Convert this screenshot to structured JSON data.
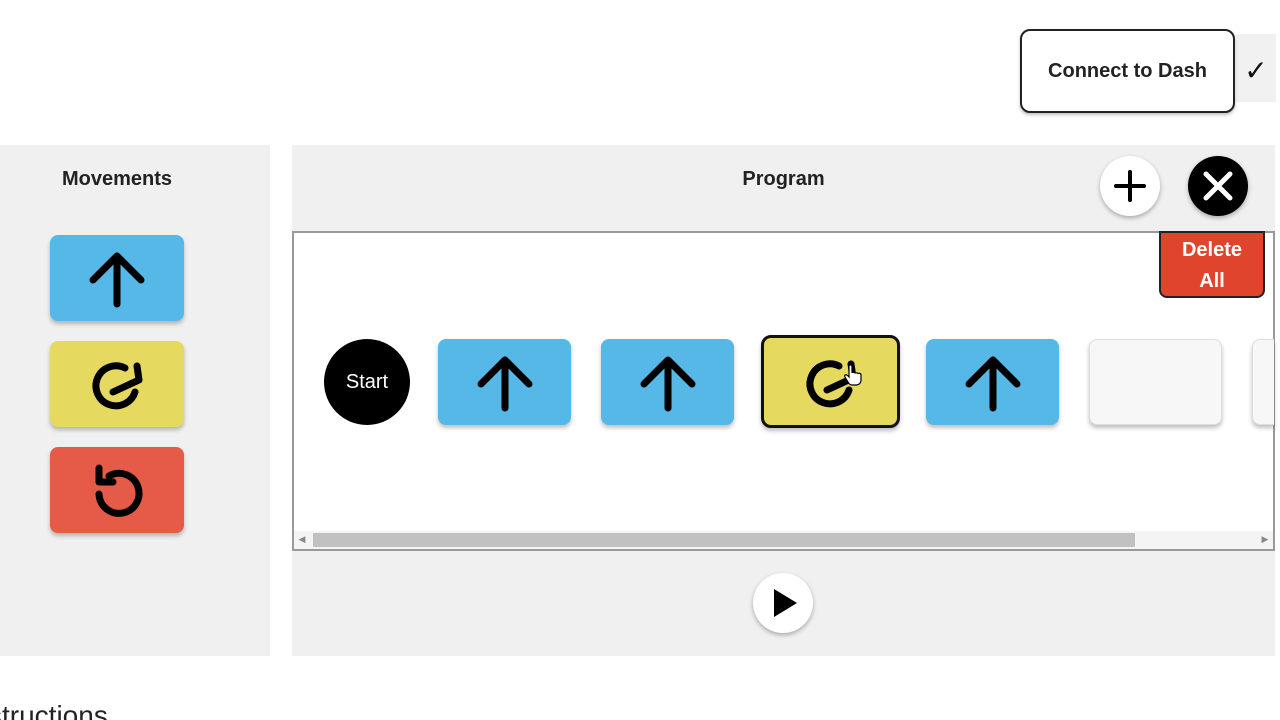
{
  "header": {
    "connect_label": "Connect to Dash",
    "connected_icon": "check-icon"
  },
  "movements": {
    "title": "Movements",
    "items": [
      {
        "name": "forward",
        "icon": "arrow-up-icon",
        "color": "#55b8e6"
      },
      {
        "name": "turn-right",
        "icon": "rotate-clockwise-icon",
        "color": "#e6d95f"
      },
      {
        "name": "turn-left",
        "icon": "rotate-counterclockwise-icon",
        "color": "#e65a48"
      }
    ]
  },
  "program": {
    "title": "Program",
    "delete_all_line1": "Delete",
    "delete_all_line2": "All",
    "start_label": "Start",
    "sequence": [
      {
        "name": "forward",
        "icon": "arrow-up-icon",
        "color": "#55b8e6"
      },
      {
        "name": "forward",
        "icon": "arrow-up-icon",
        "color": "#55b8e6"
      },
      {
        "name": "turn-right",
        "icon": "rotate-clockwise-icon",
        "color": "#e6d95f",
        "selected": true
      },
      {
        "name": "forward",
        "icon": "arrow-up-icon",
        "color": "#55b8e6"
      },
      {
        "name": "empty",
        "icon": "",
        "color": "#f7f7f7"
      }
    ]
  },
  "footer": {
    "instructions_heading": "structions"
  }
}
